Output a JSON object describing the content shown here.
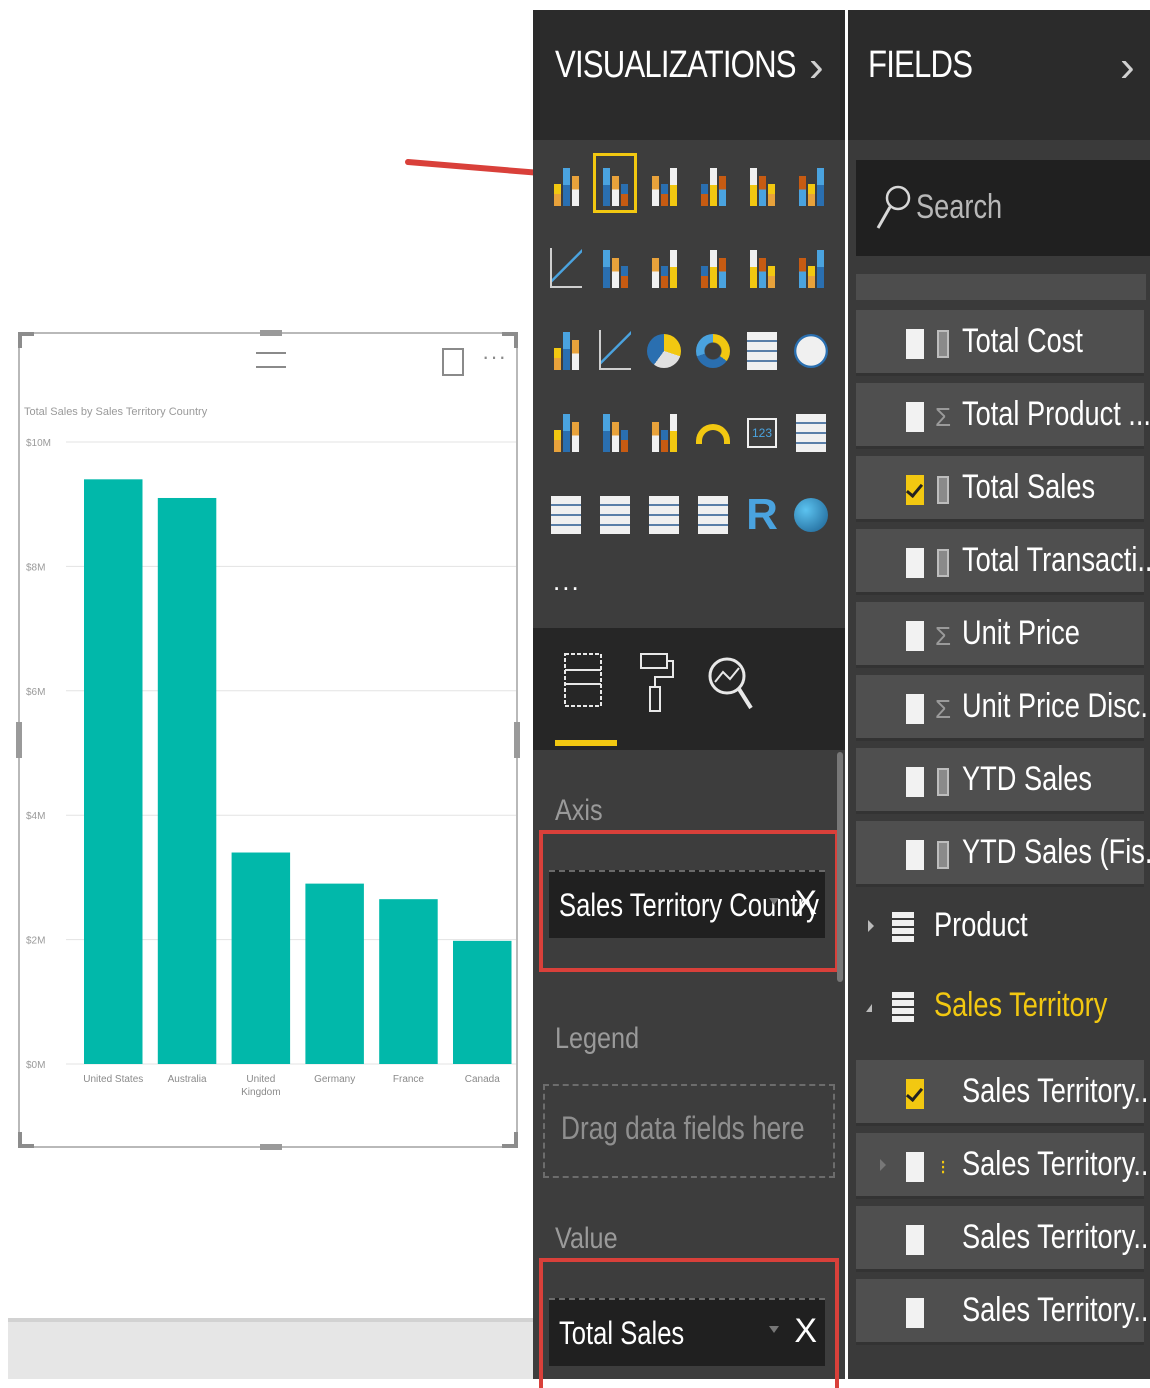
{
  "visualizations_pane": {
    "title": "VISUALIZATIONS",
    "more": "...",
    "wells": {
      "axis_label": "Axis",
      "axis_field": "Sales Territory Country",
      "legend_label": "Legend",
      "legend_placeholder": "Drag data fields here",
      "value_label": "Value",
      "value_field": "Total Sales",
      "remove": "X"
    }
  },
  "fields_pane": {
    "title": "FIELDS",
    "search_placeholder": "Search",
    "fields": [
      {
        "name": "Total Cost",
        "icon": "calc-icon",
        "checked": false
      },
      {
        "name": "Total Product ...",
        "icon": "sigma-icon",
        "checked": false
      },
      {
        "name": "Total Sales",
        "icon": "calc-icon",
        "checked": true
      },
      {
        "name": "Total Transacti...",
        "icon": "calc-icon",
        "checked": false
      },
      {
        "name": "Unit Price",
        "icon": "sigma-icon",
        "checked": false
      },
      {
        "name": "Unit Price Disc...",
        "icon": "sigma-icon",
        "checked": false
      },
      {
        "name": "YTD Sales",
        "icon": "calc-icon",
        "checked": false
      },
      {
        "name": "YTD Sales (Fis...",
        "icon": "calc-icon",
        "checked": false
      }
    ],
    "tables": [
      {
        "name": "Product",
        "expanded": false
      },
      {
        "name": "Sales Territory",
        "expanded": true
      }
    ],
    "territory_fields": [
      {
        "name": "Sales Territory...",
        "checked": true,
        "hierarchy": false
      },
      {
        "name": "Sales Territory...",
        "checked": false,
        "hierarchy": true
      },
      {
        "name": "Sales Territory...",
        "checked": false,
        "hierarchy": false
      },
      {
        "name": "Sales Territory...",
        "checked": false,
        "hierarchy": false
      }
    ]
  },
  "colors": {
    "bar": "#01b8aa",
    "accent": "#f2c811",
    "highlight_box": "#d9403a",
    "arrow": "#d9403a"
  },
  "chart_data": {
    "type": "bar",
    "title": "Total Sales by Sales Territory Country",
    "categories": [
      "United States",
      "Australia",
      "United Kingdom",
      "Germany",
      "France",
      "Canada"
    ],
    "values": [
      9.4,
      9.1,
      3.4,
      2.9,
      2.65,
      1.98
    ],
    "y_tick_labels": [
      "$10M",
      "$8M",
      "$6M",
      "$4M",
      "$2M",
      "$0M"
    ],
    "ylim": [
      0,
      10
    ],
    "grid": true
  }
}
